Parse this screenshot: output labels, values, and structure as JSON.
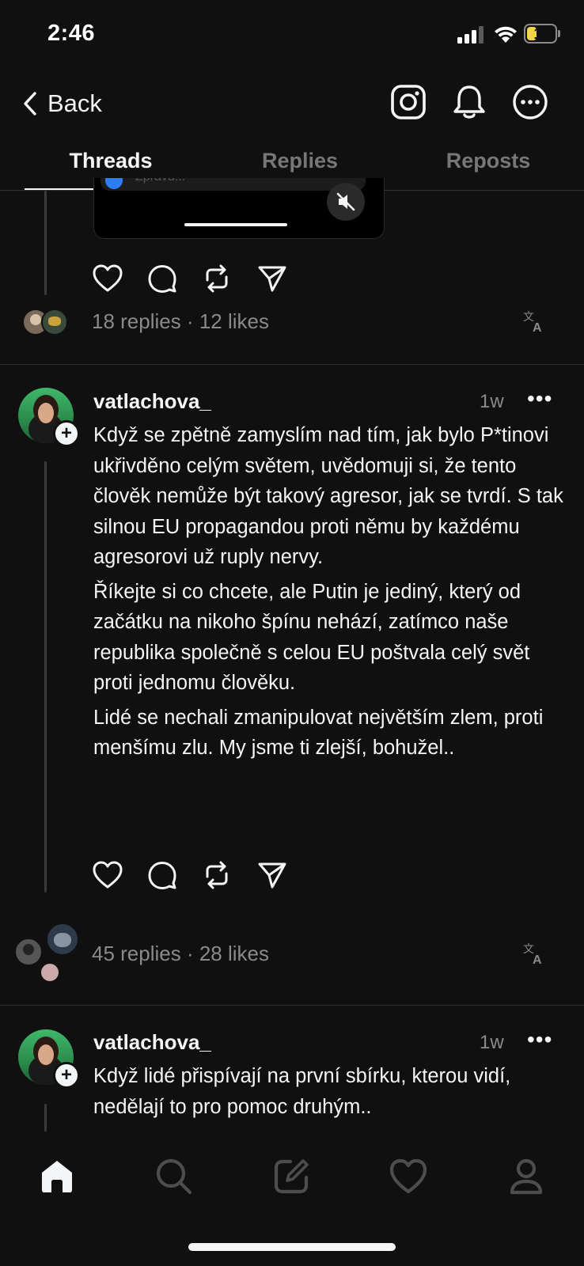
{
  "status_bar": {
    "time": "2:46",
    "battery": "14"
  },
  "nav": {
    "back_label": "Back"
  },
  "tabs": [
    {
      "label": "Threads",
      "active": true
    },
    {
      "label": "Replies",
      "active": false
    },
    {
      "label": "Reposts",
      "active": false
    }
  ],
  "posts": [
    {
      "video_partial_text": "Zprávu...",
      "stats": "18 replies · 12 likes"
    },
    {
      "username": "vatlachova_",
      "time": "1w",
      "paragraphs": [
        "Když se zpětně zamyslím nad tím, jak bylo P*tinovi ukřivděno celým světem, uvědomuji si, že tento člověk nemůže být takový agresor, jak se tvrdí. S tak silnou EU propagandou proti němu by každému agresorovi už ruply nervy.",
        "Říkejte si co chcete, ale Putin je jediný, který od začátku na nikoho špínu nehází, zatímco naše republika společně s celou EU poštvala celý svět proti jednomu člověku.",
        "Lidé se nechali zmanipulovat největším zlem, proti menšímu zlu. My jsme ti zlejší, bohužel.."
      ],
      "stats": "45 replies · 28 likes"
    },
    {
      "username": "vatlachova_",
      "time": "1w",
      "paragraphs": [
        "Když lidé přispívají na první sbírku, kterou vidí, nedělají to pro pomoc druhým.."
      ]
    }
  ],
  "icons": {
    "instagram": "instagram-icon",
    "notifications": "bell-icon",
    "more": "more-circle-icon",
    "translate": "translate-icon"
  }
}
